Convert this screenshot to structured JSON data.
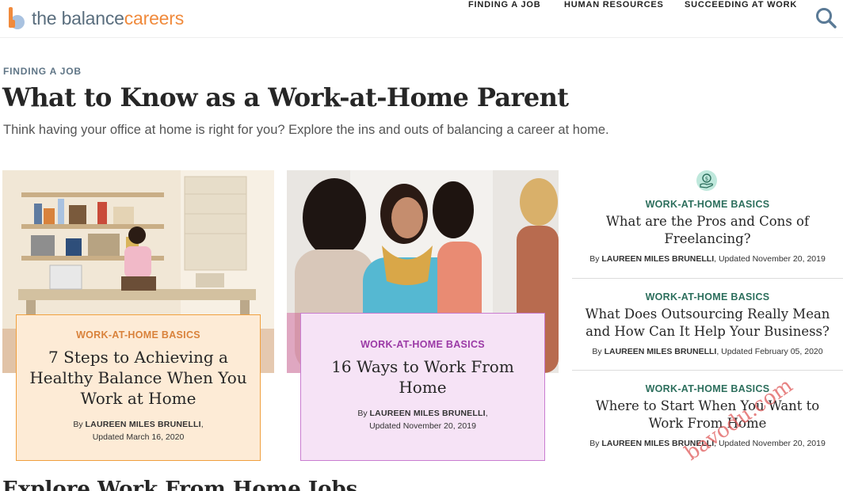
{
  "brand": {
    "name_part1": "the balance",
    "name_part2": "careers",
    "accent": "#f08a3c"
  },
  "nav": {
    "items": [
      "FINDING A JOB",
      "HUMAN RESOURCES",
      "SUCCEEDING AT WORK"
    ]
  },
  "intro": {
    "eyebrow": "FINDING A JOB",
    "title": "What to Know as a Work-at-Home Parent",
    "description": "Think having your office at home is right for you? Explore the ins and outs of balancing a career at home."
  },
  "cards": [
    {
      "tag": "WORK-AT-HOME BASICS",
      "title": "7 Steps to Achieving a Healthy Balance When You Work at Home",
      "by_prefix": "By",
      "author": "LAUREEN MILES BRUNELLI",
      "updated": "Updated March 16, 2020",
      "tag_color": "#d9823b",
      "bg": "#fdebd6"
    },
    {
      "tag": "WORK-AT-HOME BASICS",
      "title": "16 Ways to Work From Home",
      "by_prefix": "By",
      "author": "LAUREEN MILES BRUNELLI",
      "updated": "Updated November 20, 2019",
      "tag_color": "#9b3aa6",
      "bg": "#f6e3f6"
    }
  ],
  "side": [
    {
      "tag": "WORK-AT-HOME BASICS",
      "title": "What are the Pros and Cons of Freelancing?",
      "by_prefix": "By",
      "author": "LAUREEN MILES BRUNELLI",
      "updated": "Updated November 20, 2019"
    },
    {
      "tag": "WORK-AT-HOME BASICS",
      "title": "What Does Outsourcing Really Mean and How Can It Help Your Business?",
      "by_prefix": "By",
      "author": "LAUREEN MILES BRUNELLI",
      "updated": "Updated February 05, 2020"
    },
    {
      "tag": "WORK-AT-HOME BASICS",
      "title": "Where to Start When You Want to Work From Home",
      "by_prefix": "By",
      "author": "LAUREEN MILES BRUNELLI",
      "updated": "Updated November 20, 2019"
    }
  ],
  "section": {
    "title": "Explore Work From Home Jobs"
  },
  "watermark": {
    "text": "bavodu.com"
  },
  "icons": {
    "search": "search-icon",
    "side_first": "money-hand-icon"
  }
}
